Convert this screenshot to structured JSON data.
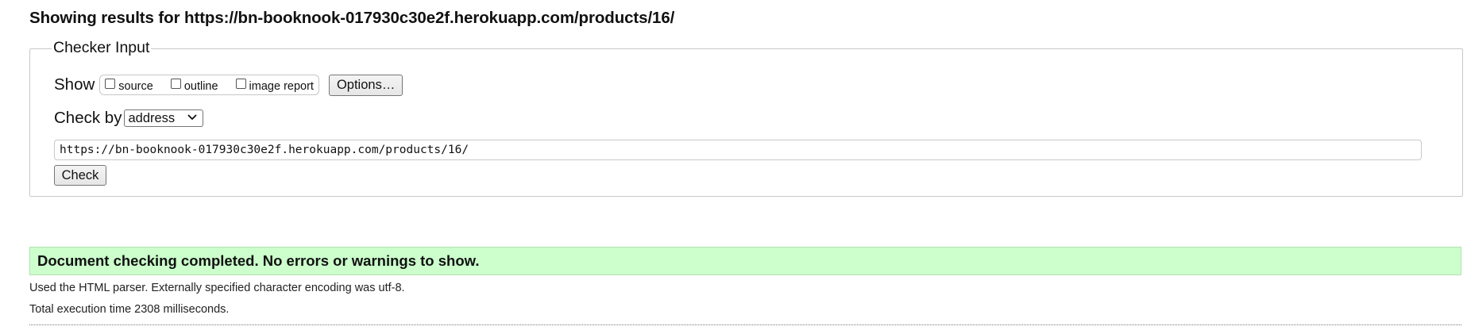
{
  "header": {
    "title": "Showing results for https://bn-booknook-017930c30e2f.herokuapp.com/products/16/"
  },
  "checker": {
    "legend": "Checker Input",
    "show_label": "Show",
    "show_options": [
      {
        "label": "source",
        "checked": false
      },
      {
        "label": "outline",
        "checked": false
      },
      {
        "label": "image report",
        "checked": false
      }
    ],
    "options_button": "Options…",
    "checkby_label": "Check by",
    "checkby_select": {
      "value": "address"
    },
    "url_input": {
      "value": "https://bn-booknook-017930c30e2f.herokuapp.com/products/16/"
    },
    "check_button": "Check"
  },
  "results": {
    "success_message": "Document checking completed. No errors or warnings to show.",
    "parser_info": "Used the HTML parser. Externally specified character encoding was utf-8.",
    "execution_time": "Total execution time 2308 milliseconds."
  },
  "colors": {
    "success_bg": "#ccffcc",
    "text": "#111111",
    "border": "#c8c8c8"
  }
}
